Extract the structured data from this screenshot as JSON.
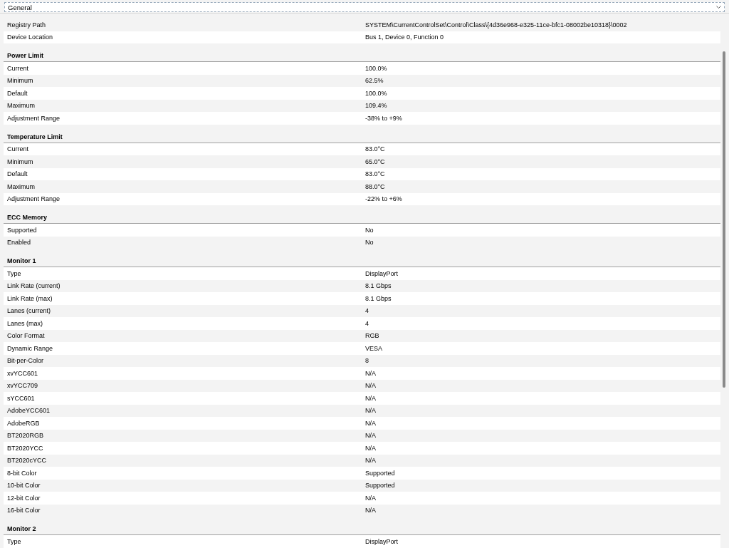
{
  "dropdown": {
    "value": "General"
  },
  "sections": [
    {
      "rows": [
        {
          "label": "Registry Path",
          "value": "SYSTEM\\CurrentControlSet\\Control\\Class\\{4d36e968-e325-11ce-bfc1-08002be10318}\\0002"
        },
        {
          "label": "Device Location",
          "value": "Bus 1, Device 0, Function 0"
        }
      ]
    },
    {
      "title": "Power Limit",
      "rows": [
        {
          "label": "Current",
          "value": "100.0%"
        },
        {
          "label": "Minimum",
          "value": "62.5%"
        },
        {
          "label": "Default",
          "value": "100.0%"
        },
        {
          "label": "Maximum",
          "value": "109.4%"
        },
        {
          "label": "Adjustment Range",
          "value": "-38% to +9%"
        }
      ]
    },
    {
      "title": "Temperature Limit",
      "rows": [
        {
          "label": "Current",
          "value": "83.0°C"
        },
        {
          "label": "Minimum",
          "value": "65.0°C"
        },
        {
          "label": "Default",
          "value": "83.0°C"
        },
        {
          "label": "Maximum",
          "value": "88.0°C"
        },
        {
          "label": "Adjustment Range",
          "value": "-22% to +6%"
        }
      ]
    },
    {
      "title": "ECC Memory",
      "rows": [
        {
          "label": "Supported",
          "value": "No"
        },
        {
          "label": "Enabled",
          "value": "No"
        }
      ]
    },
    {
      "title": "Monitor 1",
      "rows": [
        {
          "label": "Type",
          "value": "DisplayPort"
        },
        {
          "label": "Link Rate (current)",
          "value": "8.1 Gbps"
        },
        {
          "label": "Link Rate (max)",
          "value": "8.1 Gbps"
        },
        {
          "label": "Lanes (current)",
          "value": "4"
        },
        {
          "label": "Lanes (max)",
          "value": "4"
        },
        {
          "label": "Color Format",
          "value": "RGB"
        },
        {
          "label": "Dynamic Range",
          "value": "VESA"
        },
        {
          "label": "Bit-per-Color",
          "value": "8"
        },
        {
          "label": "xvYCC601",
          "value": "N/A"
        },
        {
          "label": "xvYCC709",
          "value": "N/A"
        },
        {
          "label": "sYCC601",
          "value": "N/A"
        },
        {
          "label": "AdobeYCC601",
          "value": "N/A"
        },
        {
          "label": "AdobeRGB",
          "value": "N/A"
        },
        {
          "label": "BT2020RGB",
          "value": "N/A"
        },
        {
          "label": "BT2020YCC",
          "value": "N/A"
        },
        {
          "label": "BT2020cYCC",
          "value": "N/A"
        },
        {
          "label": "8-bit Color",
          "value": "Supported"
        },
        {
          "label": "10-bit Color",
          "value": "Supported"
        },
        {
          "label": "12-bit Color",
          "value": "N/A"
        },
        {
          "label": "16-bit Color",
          "value": "N/A"
        }
      ]
    },
    {
      "title": "Monitor 2",
      "rows": [
        {
          "label": "Type",
          "value": "DisplayPort"
        }
      ]
    }
  ]
}
